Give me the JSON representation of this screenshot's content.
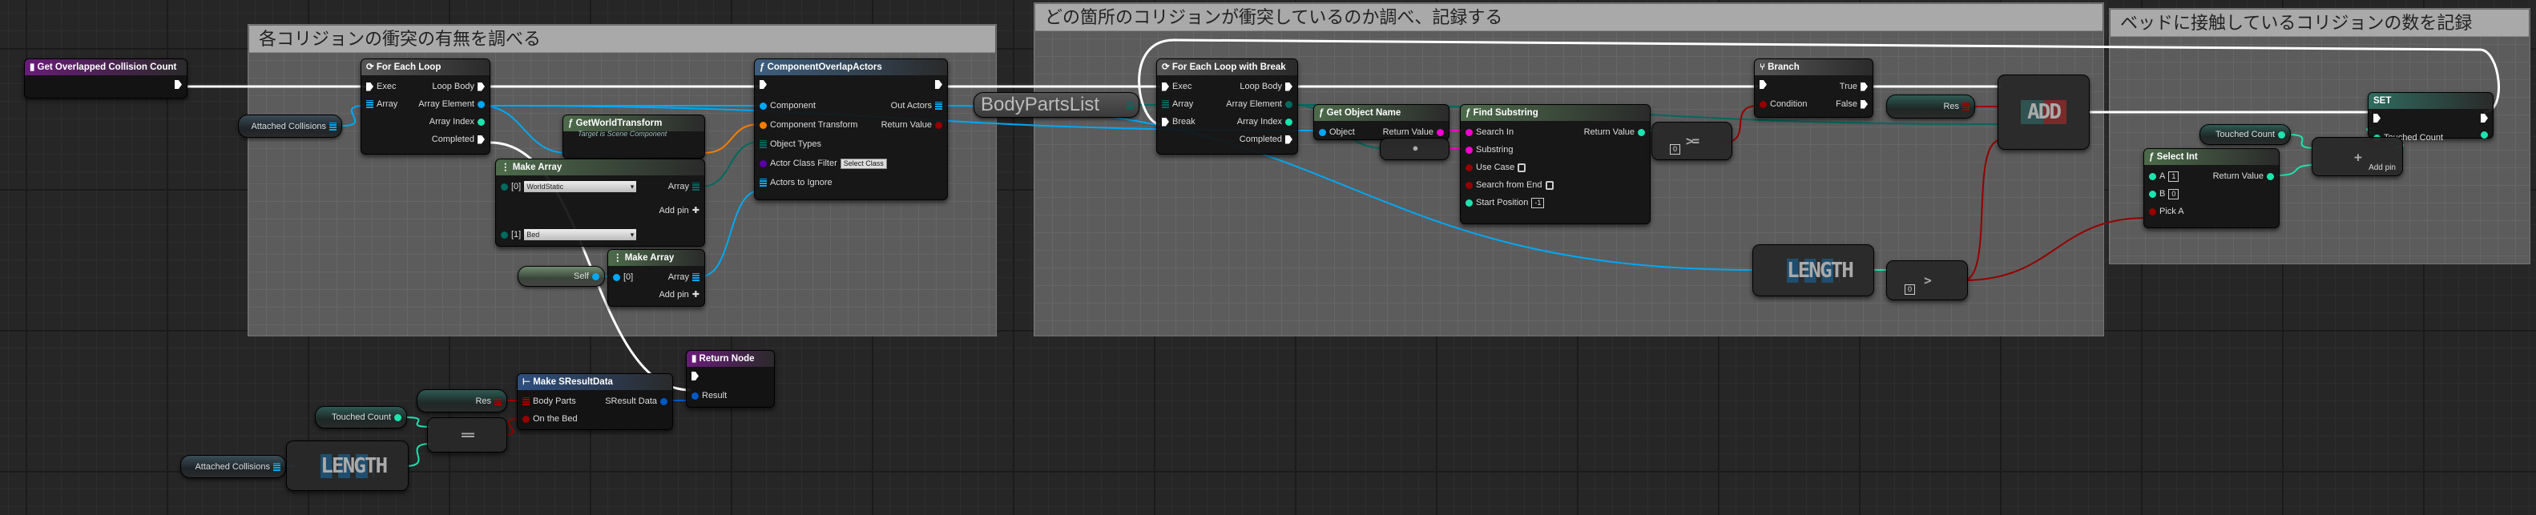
{
  "comments": [
    {
      "title": "各コリジョンの衝突の有無を調べる"
    },
    {
      "title": "どの箇所のコリジョンが衝突しているのか調べ、記録する"
    },
    {
      "title": "ベッドに接触しているコリジョンの数を記録"
    }
  ],
  "pin_colors": {
    "exec": "#ffffff",
    "object": "#00a8f4",
    "int": "#1fe3af",
    "string": "#fb00d1",
    "bool": "#960000",
    "transform": "#f57d00",
    "byte": "#006a5e",
    "class": "#5a00a8",
    "struct": "#0058c8",
    "map": "#a00000"
  },
  "nodes": [
    {
      "id": "get_overlapped",
      "title": "Get Overlapped Collision Count",
      "icon": "function-entry-icon",
      "hdr": "#6a1b7a",
      "rows": [
        [
          null,
          {
            "t": "exec"
          }
        ]
      ]
    },
    {
      "id": "for_each",
      "title": "For Each Loop",
      "icon": "loop-icon",
      "hdr": "#555",
      "rows": [
        [
          {
            "t": "exec",
            "l": "Exec"
          },
          {
            "t": "exec",
            "l": "Loop Body"
          }
        ],
        [
          {
            "t": "object",
            "a": 1,
            "l": "Array"
          },
          {
            "t": "object",
            "l": "Array Element"
          }
        ],
        [
          null,
          {
            "t": "int",
            "l": "Array Index"
          }
        ],
        [
          null,
          {
            "t": "exec",
            "l": "Completed"
          }
        ]
      ]
    },
    {
      "id": "gwt",
      "title": "GetWorldTransform",
      "sub": "Target is Scene Component",
      "icon": "function-icon",
      "hdr": "#4d6b4b",
      "rows": [
        [
          null,
          null
        ],
        [
          {
            "t": "object",
            "l": "Target"
          },
          {
            "t": "transform",
            "l": "Return Value"
          }
        ]
      ]
    },
    {
      "id": "make_array1",
      "title": "Make Array",
      "icon": "make-array-icon",
      "hdr": "#4d6b4b",
      "rows": [
        [
          {
            "t": "byte",
            "l": "[0]",
            "dd": "WorldStatic"
          },
          {
            "t": "byte",
            "a": 1,
            "l": "Array"
          }
        ],
        [
          null,
          {
            "t": "add",
            "l": "Add pin"
          }
        ],
        [
          {
            "t": "byte",
            "l": "[1]",
            "dd": "Bed"
          },
          null
        ]
      ]
    },
    {
      "id": "make_array2",
      "title": "Make Array",
      "icon": "make-array-icon",
      "hdr": "#4d6b4b",
      "rows": [
        [
          {
            "t": "object",
            "l": "[0]"
          },
          {
            "t": "object",
            "a": 1,
            "l": "Array"
          }
        ],
        [
          null,
          {
            "t": "add",
            "l": "Add pin"
          }
        ]
      ]
    },
    {
      "id": "coa",
      "title": "ComponentOverlapActors",
      "icon": "function-icon",
      "hdr": "#3d5f80",
      "rows": [
        [
          {
            "t": "exec"
          },
          {
            "t": "exec"
          }
        ],
        [
          {
            "t": "object",
            "l": "Component"
          },
          {
            "t": "object",
            "a": 1,
            "l": "Out Actors"
          }
        ],
        [
          {
            "t": "transform",
            "l": "Component Transform"
          },
          {
            "t": "bool",
            "l": "Return Value"
          }
        ],
        [
          {
            "t": "byte",
            "a": 1,
            "l": "Object Types"
          },
          null
        ],
        [
          {
            "t": "class",
            "l": "Actor Class Filter",
            "v": "Select Class"
          },
          null
        ],
        [
          {
            "t": "object",
            "a": 1,
            "l": "Actors to Ignore"
          },
          null
        ]
      ]
    },
    {
      "id": "felb",
      "title": "For Each Loop with Break",
      "icon": "loop-icon",
      "hdr": "#555",
      "rows": [
        [
          {
            "t": "exec",
            "l": "Exec"
          },
          {
            "t": "exec",
            "l": "Loop Body"
          }
        ],
        [
          {
            "t": "byte",
            "a": 1,
            "l": "Array"
          },
          {
            "t": "byte",
            "l": "Array Element"
          }
        ],
        [
          {
            "t": "exec",
            "l": "Break"
          },
          {
            "t": "int",
            "l": "Array Index"
          }
        ],
        [
          null,
          {
            "t": "exec",
            "l": "Completed"
          }
        ]
      ]
    },
    {
      "id": "gon",
      "title": "Get Object Name",
      "icon": "function-icon",
      "hdr": "#4d6b4b",
      "rows": [
        [
          {
            "t": "object",
            "l": "Object"
          },
          {
            "t": "string",
            "l": "Return Value"
          }
        ]
      ]
    },
    {
      "id": "fs",
      "title": "Find Substring",
      "icon": "function-icon",
      "hdr": "#4d6b4b",
      "rows": [
        [
          {
            "t": "string",
            "l": "Search In"
          },
          {
            "t": "int",
            "l": "Return Value"
          }
        ],
        [
          {
            "t": "string",
            "l": "Substring"
          },
          null
        ],
        [
          {
            "t": "bool",
            "l": "Use Case",
            "chk": 1
          },
          null
        ],
        [
          {
            "t": "bool",
            "l": "Search from End",
            "chk": 1
          },
          null
        ],
        [
          {
            "t": "int",
            "l": "Start Position",
            "v": "-1"
          },
          null
        ]
      ]
    },
    {
      "id": "branch",
      "title": "Branch",
      "icon": "branch-icon",
      "hdr": "#555",
      "rows": [
        [
          {
            "t": "exec"
          },
          {
            "t": "exec",
            "l": "True"
          }
        ],
        [
          {
            "t": "bool",
            "l": "Condition"
          },
          {
            "t": "exec",
            "l": "False"
          }
        ]
      ]
    },
    {
      "id": "select_int",
      "title": "Select Int",
      "icon": "function-icon",
      "hdr": "#4d6b4b",
      "rows": [
        [
          {
            "t": "int",
            "l": "A",
            "v": "1"
          },
          {
            "t": "int",
            "l": "Return Value"
          }
        ],
        [
          {
            "t": "int",
            "l": "B",
            "v": "0"
          },
          null
        ],
        [
          {
            "t": "bool",
            "l": "Pick A"
          },
          null
        ]
      ]
    },
    {
      "id": "set",
      "title": "SET",
      "icon": "",
      "hdr": "#2f6b5e",
      "rows": [
        [
          {
            "t": "exec"
          },
          {
            "t": "exec"
          }
        ],
        [
          {
            "t": "int",
            "l": "Touched Count"
          },
          {
            "t": "int"
          }
        ]
      ]
    },
    {
      "id": "ret",
      "title": "Return Node",
      "icon": "function-entry-icon",
      "hdr": "#6a1b7a",
      "rows": [
        [
          {
            "t": "exec"
          },
          null
        ],
        [
          {
            "t": "struct",
            "l": "Result"
          },
          null
        ]
      ]
    },
    {
      "id": "msr",
      "title": "Make SResultData",
      "icon": "struct-icon",
      "hdr": "#2d4f80",
      "rows": [
        [
          {
            "t": "map",
            "a": 1,
            "l": "Body Parts"
          },
          {
            "t": "struct",
            "l": "SResult Data"
          }
        ],
        [
          {
            "t": "bool",
            "l": "On the Bed"
          },
          null
        ]
      ]
    }
  ],
  "vars": [
    {
      "id": "attached1",
      "label": "Attached Collisions",
      "t": "object",
      "a": 1,
      "style": ""
    },
    {
      "id": "self",
      "label": "Self",
      "t": "object",
      "style": "green"
    },
    {
      "id": "bodyparts",
      "label": "BodyPartsList",
      "t": "byte",
      "a": 1,
      "style": "big"
    },
    {
      "id": "res1",
      "label": "Res",
      "t": "map",
      "a": 1,
      "style": "teal"
    },
    {
      "id": "tc1",
      "label": "Touched Count",
      "t": "int",
      "style": "teal"
    },
    {
      "id": "res2",
      "label": "Res",
      "t": "map",
      "a": 1,
      "style": "teal"
    },
    {
      "id": "tc2",
      "label": "Touched Count",
      "t": "int",
      "style": "teal"
    },
    {
      "id": "attached2",
      "label": "Attached Collisions",
      "t": "object",
      "a": 1,
      "style": ""
    }
  ],
  "operators": [
    {
      "id": "conv",
      "label": "•"
    },
    {
      "id": "ge",
      "label": ">=",
      "v": "0"
    },
    {
      "id": "length2",
      "label": "LENGTH"
    },
    {
      "id": "gt",
      "label": ">",
      "v": "0"
    },
    {
      "id": "add",
      "label": "ADD"
    },
    {
      "id": "addint",
      "label": "+",
      "pin_label": "Add pin"
    },
    {
      "id": "eq",
      "label": "=="
    },
    {
      "id": "length1",
      "label": "LENGTH"
    }
  ]
}
